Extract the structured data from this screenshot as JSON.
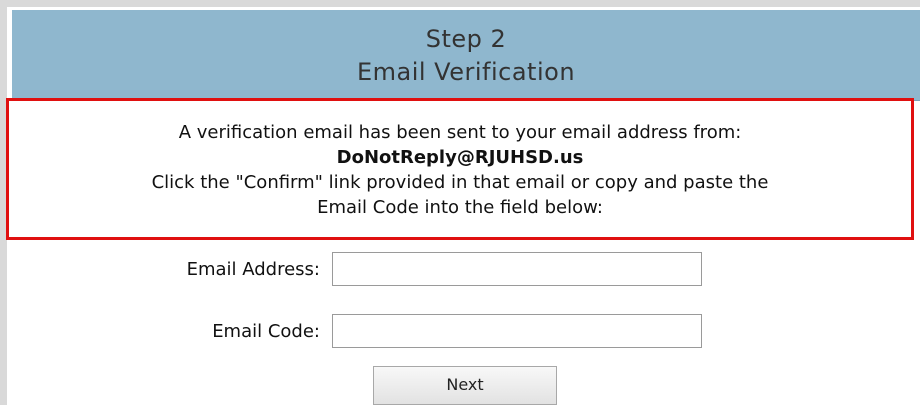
{
  "header": {
    "step": "Step 2",
    "subtitle": "Email Verification"
  },
  "notice": {
    "line1": "A verification email has been sent to your email address from:",
    "sender": "DoNotReply@RJUHSD.us",
    "line3": "Click the \"Confirm\" link provided in that email or copy and paste the",
    "line4": "Email Code into the field below:"
  },
  "form": {
    "email_label": "Email Address:",
    "email_value": "",
    "code_label": "Email Code:",
    "code_value": "",
    "next_label": "Next"
  },
  "colors": {
    "header_bg": "#8fb7ce",
    "notice_border": "#e01010"
  }
}
